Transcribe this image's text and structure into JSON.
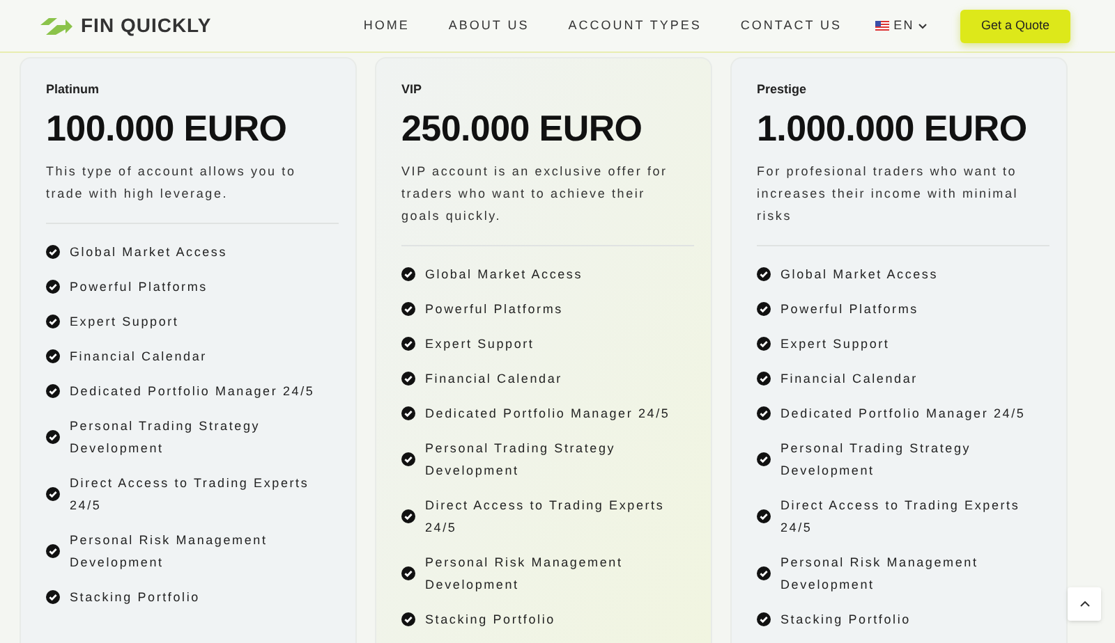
{
  "header": {
    "brand": "FIN QUICKLY",
    "nav": [
      {
        "label": "HOME"
      },
      {
        "label": "ABOUT US"
      },
      {
        "label": "ACCOUNT TYPES"
      },
      {
        "label": "CONTACT US"
      }
    ],
    "language": "EN",
    "cta": "Get a Quote"
  },
  "plans": [
    {
      "name": "Platinum",
      "price": "100.000 EURO",
      "description": "This type of account allows you to trade with high leverage.",
      "features": [
        "Global Market Access",
        "Powerful Platforms",
        "Expert Support",
        "Financial Calendar",
        "Dedicated Portfolio Manager 24/5",
        "Personal Trading Strategy Development",
        "Direct Access to Trading Experts 24/5",
        "Personal Risk Management Development",
        "Stacking Portfolio"
      ]
    },
    {
      "name": "VIP",
      "price": "250.000 EURO",
      "description": "VIP account is an exclusive offer for traders who want to achieve their goals quickly.",
      "features": [
        "Global Market Access",
        "Powerful Platforms",
        "Expert Support",
        "Financial Calendar",
        "Dedicated Portfolio Manager 24/5",
        "Personal Trading Strategy Development",
        "Direct Access to Trading Experts 24/5",
        "Personal Risk Management Development",
        "Stacking Portfolio"
      ]
    },
    {
      "name": "Prestige",
      "price": "1.000.000 EURO",
      "description": "For profesional traders who want to increases their income with minimal risks",
      "features": [
        "Global Market Access",
        "Powerful Platforms",
        "Expert Support",
        "Financial Calendar",
        "Dedicated Portfolio Manager 24/5",
        "Personal Trading Strategy Development",
        "Direct Access to Trading Experts 24/5",
        "Personal Risk Management Development",
        "Stacking Portfolio"
      ]
    }
  ]
}
